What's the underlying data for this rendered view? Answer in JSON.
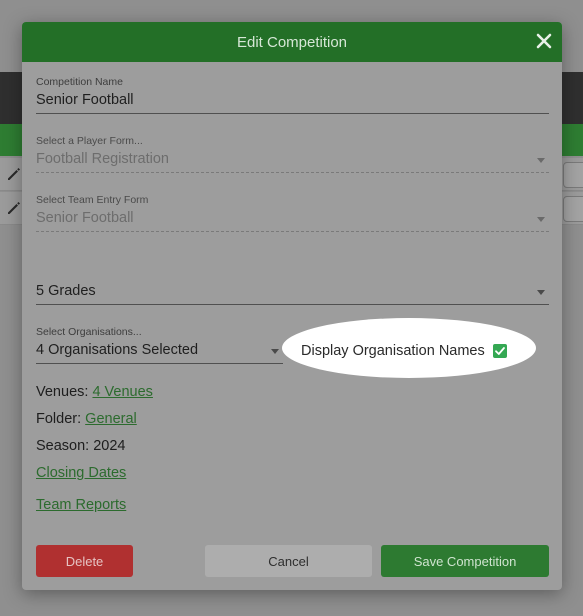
{
  "modal": {
    "title": "Edit Competition"
  },
  "form": {
    "competition_name": {
      "label": "Competition Name",
      "value": "Senior Football"
    },
    "player_form": {
      "label": "Select a Player Form...",
      "value": "Football Registration"
    },
    "team_entry_form": {
      "label": "Select Team Entry Form",
      "value": "Senior Football"
    },
    "grades": {
      "value": "5 Grades"
    },
    "organisations": {
      "label": "Select Organisations...",
      "value": "4 Organisations Selected"
    },
    "display_org_names": {
      "label": "Display Organisation Names",
      "checked": true
    }
  },
  "info": {
    "venues_label": "Venues:",
    "venues_link": "4 Venues",
    "folder_label": "Folder:",
    "folder_link": "General",
    "season_text": "Season: 2024",
    "closing_dates_link": "Closing Dates",
    "team_reports_link": "Team Reports"
  },
  "buttons": {
    "delete": "Delete",
    "cancel": "Cancel",
    "save": "Save Competition"
  },
  "colors": {
    "header_green": "#236f27",
    "save_green": "#2d7a31",
    "delete_red": "#b03030",
    "checkbox_green": "#34a853",
    "link_green": "#2c6b2e"
  },
  "icons": {
    "close": "close-icon",
    "pencil": "pencil-icon",
    "dropdown": "chevron-down-icon",
    "check": "check-icon"
  }
}
